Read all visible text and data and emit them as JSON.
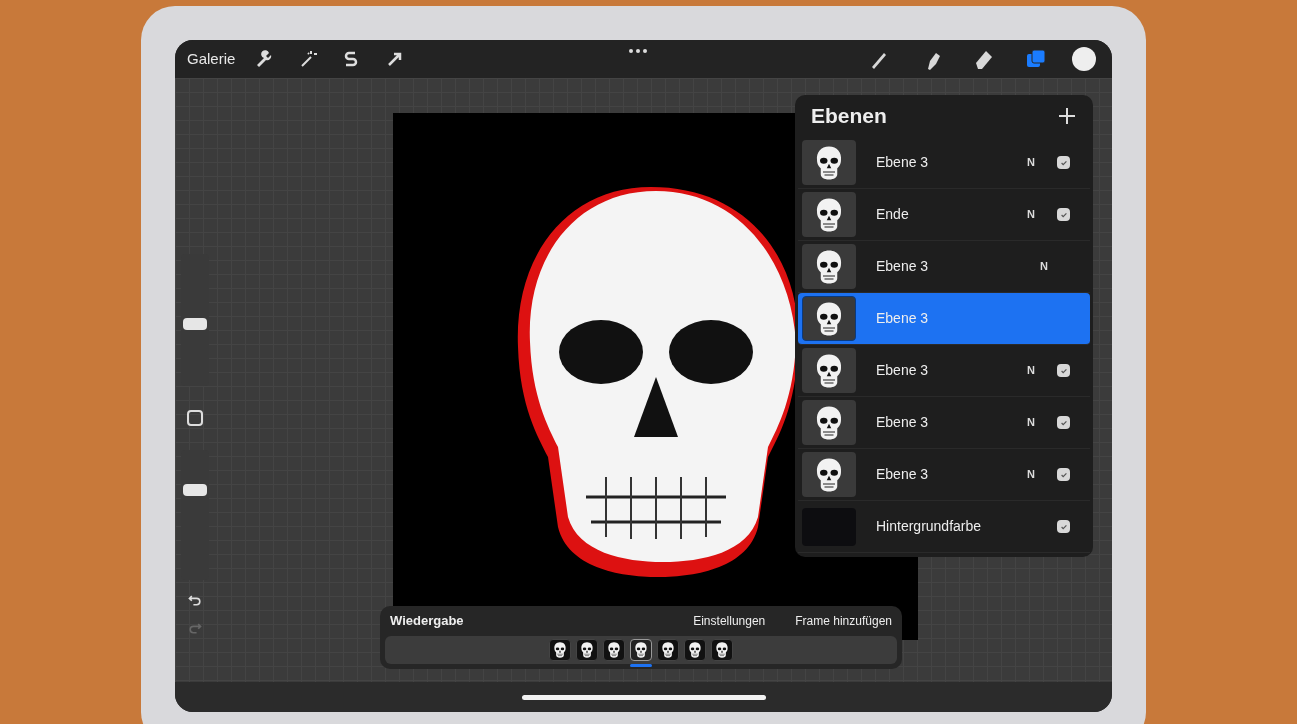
{
  "toolbar": {
    "gallery": "Galerie",
    "tools": [
      {
        "kind": "brush",
        "selected": false
      },
      {
        "kind": "smudge",
        "selected": false
      },
      {
        "kind": "eraser",
        "selected": false
      },
      {
        "kind": "layers",
        "selected": true
      }
    ]
  },
  "sidebar": {
    "size_slider": {
      "level": 0.47
    },
    "opacity_slider": {
      "level": 0.69
    }
  },
  "layers": {
    "title": "Ebenen",
    "items": [
      {
        "kind": "skull",
        "name": "Ebene 3",
        "blend": "N",
        "visible": true,
        "selected": false
      },
      {
        "kind": "skull",
        "name": "Ende",
        "blend": "N",
        "visible": true,
        "selected": false
      },
      {
        "kind": "skull",
        "name": "Ebene 3",
        "blend": "N",
        "selected": false
      },
      {
        "kind": "skull",
        "name": "Ebene 3",
        "selected": true
      },
      {
        "kind": "skull",
        "name": "Ebene 3",
        "blend": "N",
        "visible": true,
        "selected": false
      },
      {
        "kind": "skull",
        "name": "Ebene 3",
        "blend": "N",
        "visible": true,
        "selected": false
      },
      {
        "kind": "skull",
        "name": "Ebene 3",
        "blend": "N",
        "visible": true,
        "selected": false
      },
      {
        "kind": "fill",
        "name": "Hintergrundfarbe",
        "visible": true,
        "selected": false
      }
    ]
  },
  "timeline": {
    "title": "Wiedergabe",
    "actions": [
      "Einstellungen",
      "Frame hinzufügen"
    ],
    "frames": [
      {
        "selected": false
      },
      {
        "selected": false
      },
      {
        "selected": false
      },
      {
        "selected": true
      },
      {
        "selected": false
      },
      {
        "selected": false
      },
      {
        "selected": false
      }
    ]
  }
}
